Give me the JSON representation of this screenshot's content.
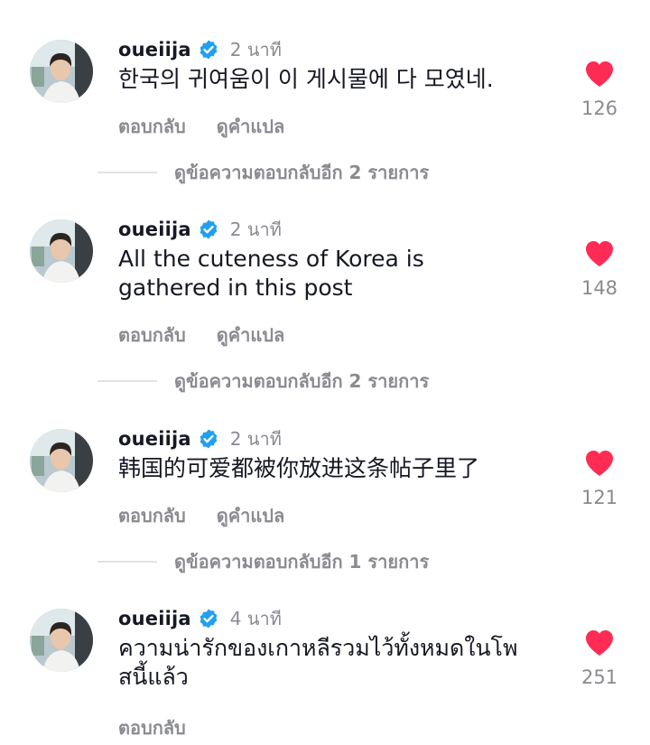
{
  "comments": [
    {
      "username": "oueiija",
      "time": "2 นาที",
      "text": "한국의 귀여움이 이 게시물에 다 모였네.",
      "reply_label": "ตอบกลับ",
      "translate_label": "ดูคำแปล",
      "likes": "126",
      "more_replies": "ดูข้อความตอบกลับอีก 2 รายการ"
    },
    {
      "username": "oueiija",
      "time": "2 นาที",
      "text": "All the cuteness of Korea is gathered in this post",
      "reply_label": "ตอบกลับ",
      "translate_label": "ดูคำแปล",
      "likes": "148",
      "more_replies": "ดูข้อความตอบกลับอีก 2 รายการ"
    },
    {
      "username": "oueiija",
      "time": "2 นาที",
      "text": "韩国的可爱都被你放进这条帖子里了",
      "reply_label": "ตอบกลับ",
      "translate_label": "ดูคำแปล",
      "likes": "121",
      "more_replies": "ดูข้อความตอบกลับอีก 1 รายการ"
    },
    {
      "username": "oueiija",
      "time": "4 นาที",
      "text": "ความน่ารักของเกาหลีรวมไว้ทั้งหมดในโพสนี้แล้ว",
      "reply_label": "ตอบกลับ",
      "likes": "251"
    }
  ],
  "colors": {
    "like": "#fe2c55",
    "verified": "#20a0f0",
    "secondary_text": "#8a8b91"
  },
  "icons": {
    "verified": "verified-badge-icon",
    "like": "heart-icon"
  }
}
